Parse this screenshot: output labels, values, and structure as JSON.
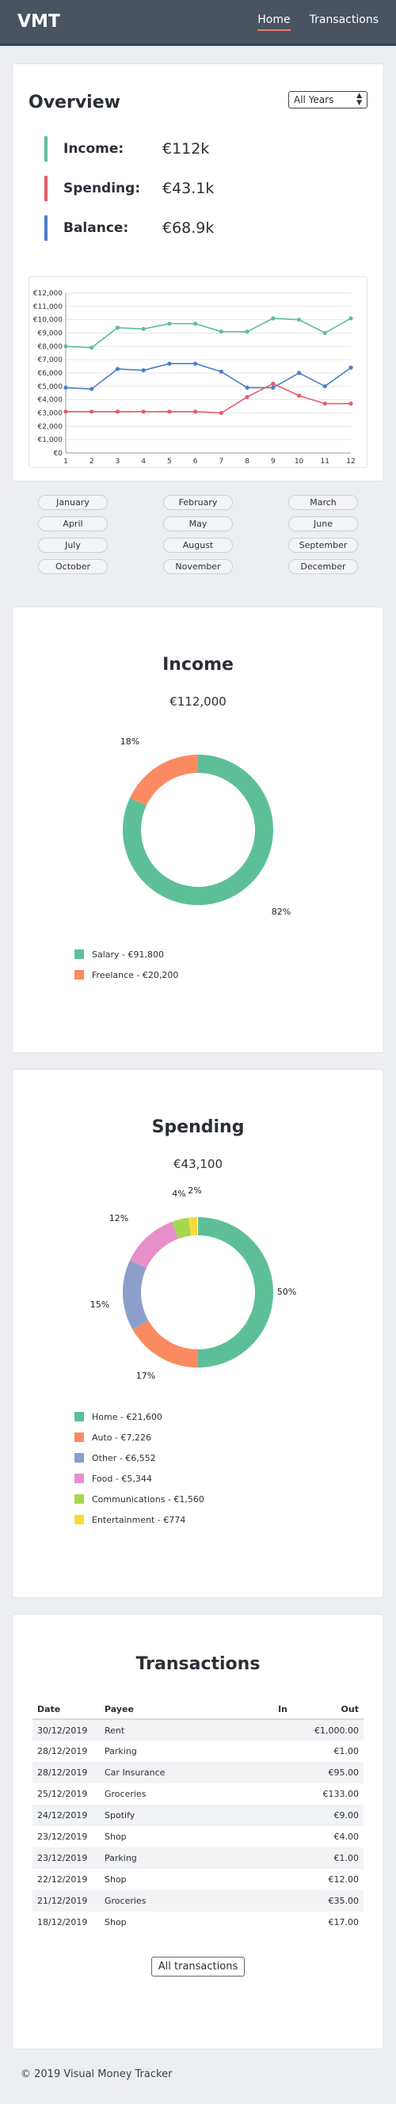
{
  "nav": {
    "brand": "VMT",
    "links": [
      "Home",
      "Transactions"
    ]
  },
  "overview": {
    "title": "Overview",
    "year_select": "All Years",
    "stats": [
      {
        "label": "Income:",
        "value": "€112k",
        "color": "#5dbf98"
      },
      {
        "label": "Spending:",
        "value": "€43.1k",
        "color": "#e85a66"
      },
      {
        "label": "Balance:",
        "value": "€68.9k",
        "color": "#4c7ec9"
      }
    ]
  },
  "chart_data": {
    "type": "line",
    "x": [
      1,
      2,
      3,
      4,
      5,
      6,
      7,
      8,
      9,
      10,
      11,
      12
    ],
    "ylim": [
      0,
      12000
    ],
    "yticks": [
      "€0",
      "€1,000",
      "€2,000",
      "€3,000",
      "€4,000",
      "€5,000",
      "€6,000",
      "€7,000",
      "€8,000",
      "€9,000",
      "€10,000",
      "€11,000",
      "€12,000"
    ],
    "series": [
      {
        "color": "#5dbf98",
        "values": [
          8000,
          7900,
          9400,
          9300,
          9700,
          9700,
          9100,
          9100,
          10100,
          10000,
          9000,
          10100
        ]
      },
      {
        "color": "#4c7ec9",
        "values": [
          4900,
          4800,
          6300,
          6200,
          6700,
          6700,
          6100,
          4900,
          4900,
          6000,
          5000,
          6400
        ]
      },
      {
        "color": "#e85a66",
        "values": [
          3100,
          3100,
          3100,
          3100,
          3100,
          3100,
          3000,
          4200,
          5200,
          4300,
          3700,
          3700
        ]
      }
    ],
    "grid": true
  },
  "months": [
    "January",
    "February",
    "March",
    "April",
    "May",
    "June",
    "July",
    "August",
    "September",
    "October",
    "November",
    "December"
  ],
  "income": {
    "title": "Income",
    "total": "€112,000",
    "slices": [
      {
        "label": "Salary - €91,800",
        "pct": "82%",
        "value": 0.82,
        "color": "#5dbf98"
      },
      {
        "label": "Freelance - €20,200",
        "pct": "18%",
        "value": 0.18,
        "color": "#fb8a60"
      }
    ]
  },
  "spending": {
    "title": "Spending",
    "total": "€43,100",
    "slices": [
      {
        "label": "Home - €21,600",
        "pct": "50%",
        "value": 0.5,
        "color": "#5dbf98"
      },
      {
        "label": "Auto - €7,226",
        "pct": "17%",
        "value": 0.168,
        "color": "#fb8a60"
      },
      {
        "label": "Other - €6,552",
        "pct": "15%",
        "value": 0.152,
        "color": "#8b9fca"
      },
      {
        "label": "Food - €5,344",
        "pct": "12%",
        "value": 0.124,
        "color": "#e68fcb"
      },
      {
        "label": "Communications - €1,560",
        "pct": "4%",
        "value": 0.036,
        "color": "#a7d64f"
      },
      {
        "label": "Entertainment - €774",
        "pct": "2%",
        "value": 0.018,
        "color": "#f8da3a"
      }
    ]
  },
  "transactions": {
    "title": "Transactions",
    "headers": [
      "Date",
      "Payee",
      "In",
      "Out"
    ],
    "rows": [
      [
        "30/12/2019",
        "Rent",
        "",
        "€1,000.00"
      ],
      [
        "28/12/2019",
        "Parking",
        "",
        "€1.00"
      ],
      [
        "28/12/2019",
        "Car Insurance",
        "",
        "€95.00"
      ],
      [
        "25/12/2019",
        "Groceries",
        "",
        "€133.00"
      ],
      [
        "24/12/2019",
        "Spotify",
        "",
        "€9.00"
      ],
      [
        "23/12/2019",
        "Shop",
        "",
        "€4.00"
      ],
      [
        "23/12/2019",
        "Parking",
        "",
        "€1.00"
      ],
      [
        "22/12/2019",
        "Shop",
        "",
        "€12.00"
      ],
      [
        "21/12/2019",
        "Groceries",
        "",
        "€35.00"
      ],
      [
        "18/12/2019",
        "Shop",
        "",
        "€17.00"
      ]
    ],
    "button": "All transactions"
  },
  "footer": "© 2019 Visual Money Tracker"
}
